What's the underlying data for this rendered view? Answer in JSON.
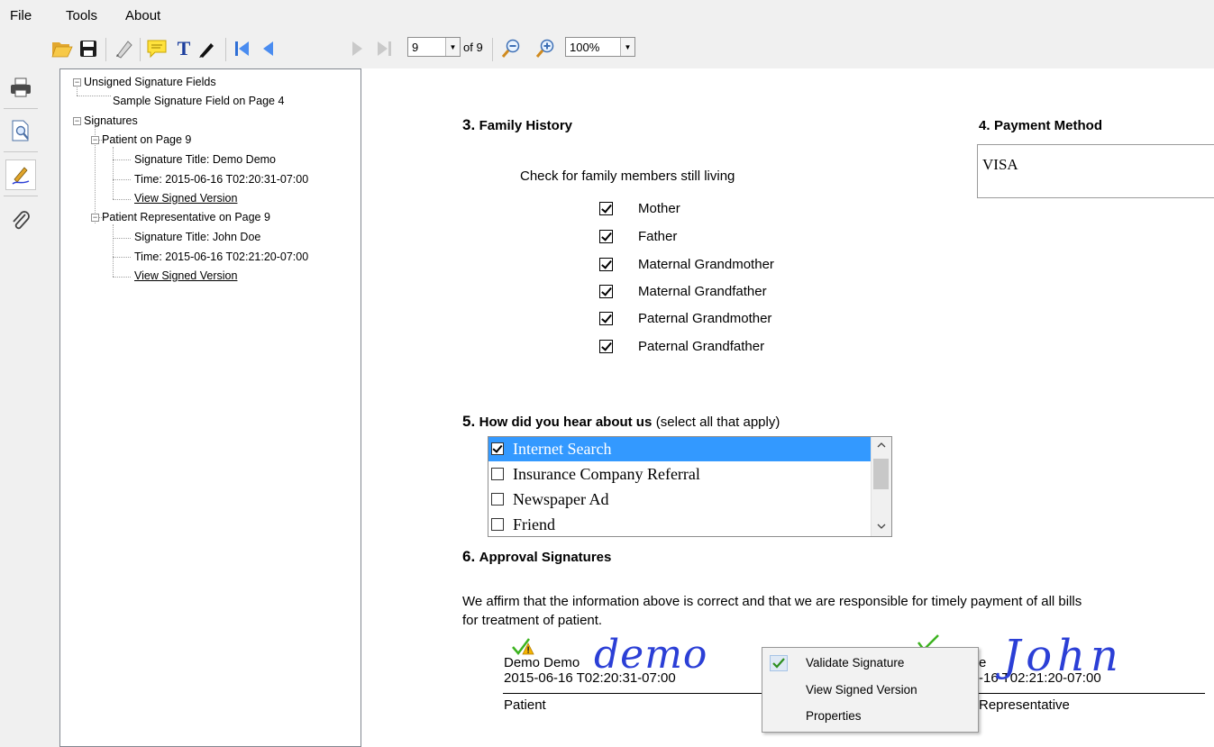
{
  "menu": [
    "File",
    "Tools",
    "About"
  ],
  "toolbar": {
    "page_value": "9",
    "page_of": "of 9",
    "zoom_value": "100%"
  },
  "tree": {
    "unsigned_header": "Unsigned Signature Fields",
    "unsigned_item": "Sample Signature Field on Page 4",
    "signatures_header": "Signatures",
    "patient": {
      "label": "Patient on Page 9",
      "title": "Signature Title: Demo Demo",
      "time": "Time: 2015-06-16 T02:20:31-07:00",
      "view": "View Signed Version"
    },
    "representative": {
      "label": "Patient Representative on Page 9",
      "title": "Signature Title: John Doe",
      "time": "Time: 2015-06-16 T02:21:20-07:00",
      "view": "View Signed Version"
    }
  },
  "document": {
    "family": {
      "num": "3.",
      "title": "Family History",
      "instruction": "Check for family members still living",
      "members": [
        {
          "label": "Mother",
          "checked": true
        },
        {
          "label": "Father",
          "checked": true
        },
        {
          "label": "Maternal Grandmother",
          "checked": true
        },
        {
          "label": "Maternal Grandfather",
          "checked": true
        },
        {
          "label": "Paternal Grandmother",
          "checked": true
        },
        {
          "label": "Paternal Grandfather",
          "checked": true
        }
      ]
    },
    "payment": {
      "num": "4.",
      "title": "Payment Method",
      "value": "VISA"
    },
    "hear": {
      "num": "5.",
      "title": "How did you hear about us",
      "suffix": "(select all that apply)",
      "options": [
        {
          "label": "Internet Search",
          "checked": true,
          "selected": true
        },
        {
          "label": "Insurance Company Referral",
          "checked": false,
          "selected": false
        },
        {
          "label": "Newspaper Ad",
          "checked": false,
          "selected": false
        },
        {
          "label": "Friend",
          "checked": false,
          "selected": false
        }
      ]
    },
    "approval": {
      "num": "6.",
      "title": "Approval Signatures",
      "affirm_line1": "We affirm that the information above is correct and that we are responsible for timely payment of all bills",
      "affirm_line2": "for treatment of patient.",
      "sig1": {
        "name": "Demo Demo",
        "time": "2015-06-16 T02:20:31-07:00",
        "role": "Patient",
        "handwriting": "demo"
      },
      "sig2": {
        "name_partial": "e",
        "time_partial": "-16 T02:21:20-07:00",
        "role_partial": "Representative",
        "handwriting": "John"
      }
    }
  },
  "context_menu": [
    {
      "label": "Validate Signature",
      "checked": true
    },
    {
      "label": "View Signed Version",
      "checked": false
    },
    {
      "label": "Properties",
      "checked": false
    }
  ],
  "colors": {
    "chrome": "#f0f0f0",
    "selection": "#3399ff",
    "ink": "#2b3fd6",
    "valid_check": "#3cb31f",
    "warning": "#f5b400"
  }
}
